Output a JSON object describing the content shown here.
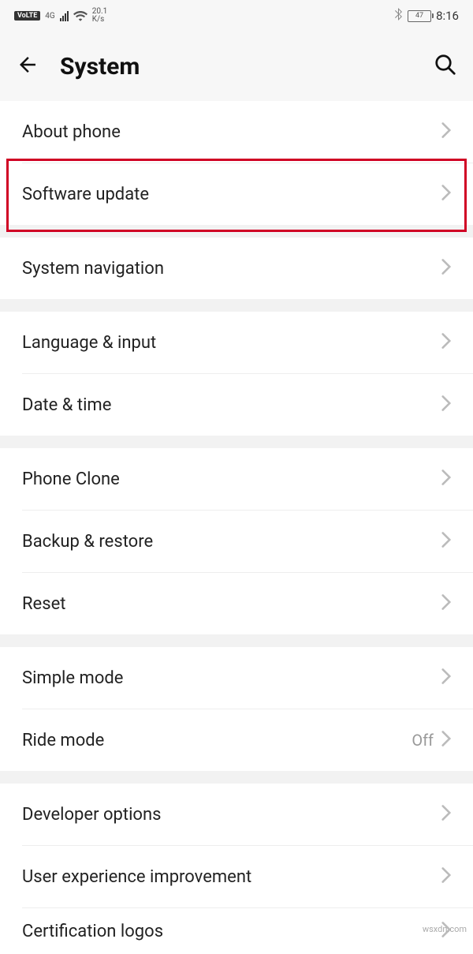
{
  "status_bar": {
    "volte": "VoLTE",
    "network": "4G",
    "speed_value": "20.1",
    "speed_unit": "K/s",
    "battery_level": "47",
    "time": "8:16"
  },
  "header": {
    "title": "System"
  },
  "sections": [
    [
      {
        "label": "About phone",
        "value": ""
      },
      {
        "label": "Software update",
        "value": ""
      }
    ],
    [
      {
        "label": "System navigation",
        "value": ""
      }
    ],
    [
      {
        "label": "Language & input",
        "value": ""
      },
      {
        "label": "Date & time",
        "value": ""
      }
    ],
    [
      {
        "label": "Phone Clone",
        "value": ""
      },
      {
        "label": "Backup & restore",
        "value": ""
      },
      {
        "label": "Reset",
        "value": ""
      }
    ],
    [
      {
        "label": "Simple mode",
        "value": ""
      },
      {
        "label": "Ride mode",
        "value": "Off"
      }
    ],
    [
      {
        "label": "Developer options",
        "value": ""
      },
      {
        "label": "User experience improvement",
        "value": ""
      },
      {
        "label": "Certification logos",
        "value": ""
      }
    ]
  ],
  "watermark": "wsxdn.com"
}
